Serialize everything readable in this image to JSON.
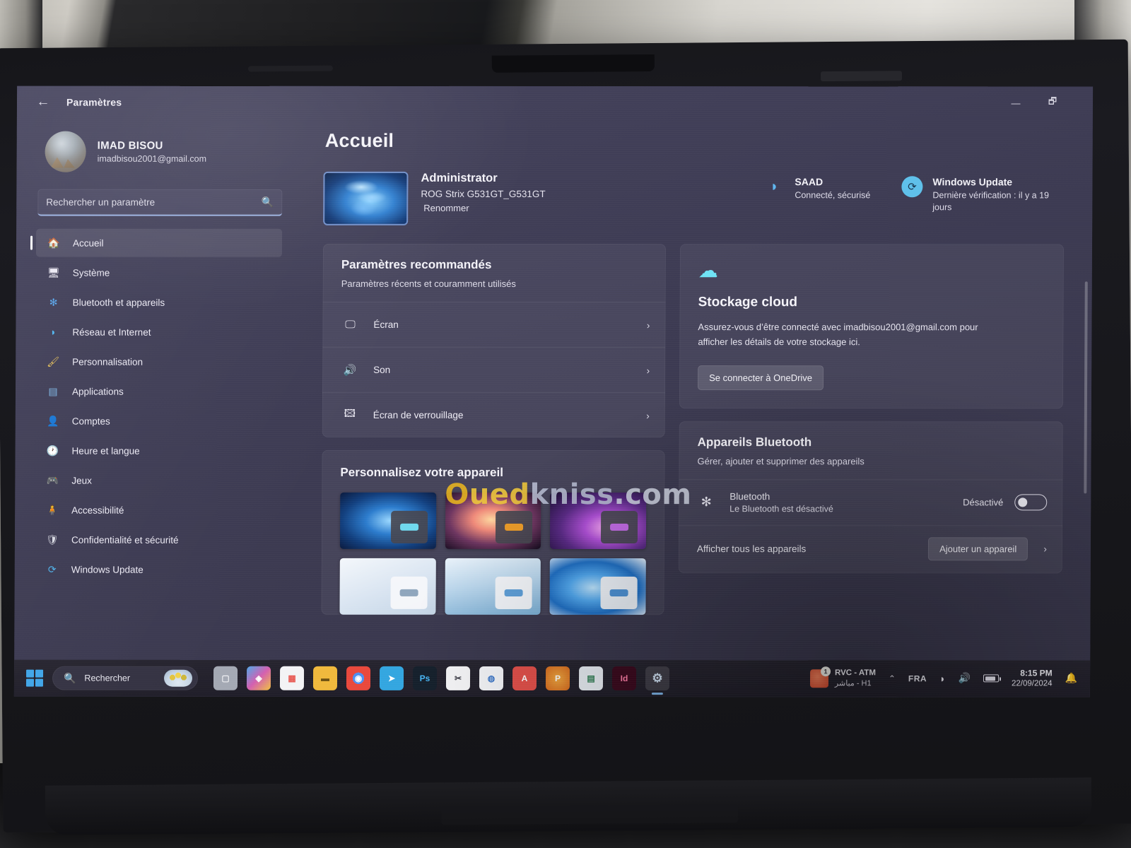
{
  "window": {
    "title": "Paramètres",
    "back_icon": "back-arrow-icon",
    "minimize_label": "—",
    "restore_label": "🗗"
  },
  "sidebar": {
    "account": {
      "name": "IMAD BISOU",
      "email": "imadbisou2001@gmail.com"
    },
    "search": {
      "placeholder": "Rechercher un paramètre",
      "value": "",
      "icon": "search-icon"
    },
    "items": [
      {
        "label": "Accueil",
        "icon": "home-icon",
        "active": true
      },
      {
        "label": "Système",
        "icon": "display-icon",
        "active": false
      },
      {
        "label": "Bluetooth et appareils",
        "icon": "bluetooth-icon",
        "active": false
      },
      {
        "label": "Réseau et Internet",
        "icon": "wifi-icon",
        "active": false
      },
      {
        "label": "Personnalisation",
        "icon": "brush-icon",
        "active": false
      },
      {
        "label": "Applications",
        "icon": "apps-icon",
        "active": false
      },
      {
        "label": "Comptes",
        "icon": "person-icon",
        "active": false
      },
      {
        "label": "Heure et langue",
        "icon": "clock-icon",
        "active": false
      },
      {
        "label": "Jeux",
        "icon": "gamepad-icon",
        "active": false
      },
      {
        "label": "Accessibilité",
        "icon": "accessibility-icon",
        "active": false
      },
      {
        "label": "Confidentialité et sécurité",
        "icon": "shield-icon",
        "active": false
      },
      {
        "label": "Windows Update",
        "icon": "update-icon",
        "active": false
      }
    ]
  },
  "main": {
    "page_title": "Accueil",
    "device": {
      "name": "Administrator",
      "model": "ROG Strix G531GT_G531GT",
      "rename_label": "Renommer"
    },
    "status": [
      {
        "title": "SAAD",
        "subtitle": "Connecté, sécurisé",
        "icon": "wifi-icon"
      },
      {
        "title": "Windows Update",
        "subtitle": "Dernière vérification : il y a 19 jours",
        "icon": "update-icon"
      }
    ],
    "recommended": {
      "title": "Paramètres recommandés",
      "subtitle": "Paramètres récents et couramment utilisés",
      "rows": [
        {
          "label": "Écran",
          "icon": "monitor-icon",
          "chevron": "›"
        },
        {
          "label": "Son",
          "icon": "speaker-icon",
          "chevron": "›"
        },
        {
          "label": "Écran de verrouillage",
          "icon": "lock-screen-icon",
          "chevron": "›"
        }
      ]
    },
    "personalize": {
      "title": "Personnalisez votre appareil",
      "thumbs": [
        "wallpaper-bloom-blue",
        "wallpaper-flora-orange",
        "wallpaper-glow-purple",
        "wallpaper-bloom-light",
        "wallpaper-captured-motion",
        "wallpaper-bloom-blue-light"
      ]
    },
    "cloud": {
      "icon": "cloud-icon",
      "title": "Stockage cloud",
      "text": "Assurez-vous d’être connecté avec imadbisou2001@gmail.com pour afficher les détails de votre stockage ici.",
      "button": "Se connecter à OneDrive"
    },
    "bluetooth": {
      "title": "Appareils Bluetooth",
      "subtitle": "Gérer, ajouter et supprimer des appareils",
      "device_label": "Bluetooth",
      "device_state_text": "Le Bluetooth est désactivé",
      "toggle_label": "Désactivé",
      "toggle_on": false,
      "show_all_label": "Afficher tous les appareils",
      "add_device_label": "Ajouter un appareil",
      "chevron": "›"
    }
  },
  "watermark": {
    "part1": "O",
    "part2": "ued",
    "part3": "kniss",
    "part4": ".com"
  },
  "taskbar": {
    "start_icon": "windows-start-icon",
    "search": {
      "placeholder": "Rechercher",
      "icon": "search-icon",
      "weather_icon": "weather-widget-icon"
    },
    "apps": [
      {
        "name": "task-view-icon",
        "glyph": "▯",
        "color": "#cfd3dc",
        "bg": "#8e93a0"
      },
      {
        "name": "copilot-icon",
        "glyph": "◈",
        "color": "#ffffff",
        "bg": "#d45fb0"
      },
      {
        "name": "microsoft-store-icon",
        "glyph": "▦",
        "color": "#e8554f",
        "bg": "#f2f2f4"
      },
      {
        "name": "file-explorer-icon",
        "glyph": "▬",
        "color": "#2f2a1a",
        "bg": "#f0b93c"
      },
      {
        "name": "chrome-icon",
        "glyph": "◉",
        "color": "#ffffff",
        "bg": "#e8e8ea"
      },
      {
        "name": "telegram-icon",
        "glyph": "➤",
        "color": "#ffffff",
        "bg": "#33a6e0"
      },
      {
        "name": "photoshop-icon",
        "glyph": "Ps",
        "color": "#49b6f5",
        "bg": "#15202c"
      },
      {
        "name": "snipping-tool-icon",
        "glyph": "✂",
        "color": "#3a3a44",
        "bg": "#f5f5f7"
      },
      {
        "name": "adobe-reader-blue-icon",
        "glyph": "◍",
        "color": "#3e78c8",
        "bg": "#f3f4f7"
      },
      {
        "name": "adobe-acrobat-icon",
        "glyph": "A",
        "color": "#ffffff",
        "bg": "#e1504a"
      },
      {
        "name": "powerpoint-icon",
        "glyph": "P",
        "color": "#ffffff",
        "bg": "#e08232"
      },
      {
        "name": "excel-icon",
        "glyph": "▤",
        "color": "#2e7d52",
        "bg": "#e9eef4"
      },
      {
        "name": "indesign-icon",
        "glyph": "Id",
        "color": "#ff7fa8",
        "bg": "#3b0a1e"
      },
      {
        "name": "settings-icon",
        "glyph": "⚙",
        "color": "#cfe0f2",
        "bg": "transparent",
        "active": true
      }
    ],
    "tray": {
      "media_title": "RVC - ATM",
      "media_subtitle": "مباشر - H1",
      "media_badge": "1",
      "overflow_icon": "chevron-up-icon",
      "language": "FRA",
      "wifi_icon": "wifi-icon",
      "volume_icon": "volume-icon",
      "battery_icon": "battery-icon",
      "time": "8:15 PM",
      "date": "22/09/2024",
      "notification_icon": "bell-icon"
    }
  }
}
